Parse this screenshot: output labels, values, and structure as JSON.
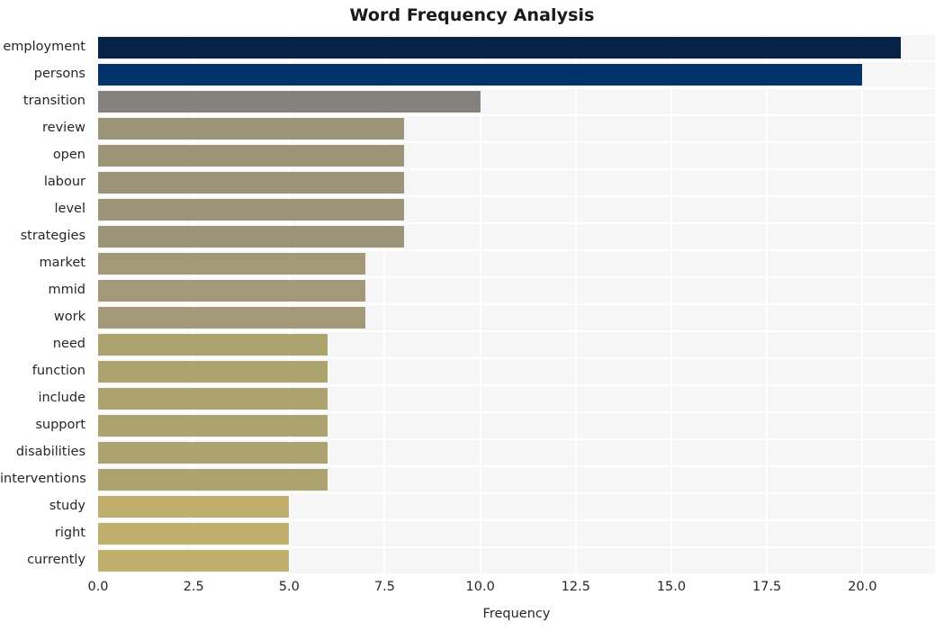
{
  "chart_data": {
    "type": "bar",
    "orientation": "horizontal",
    "title": "Word Frequency Analysis",
    "xlabel": "Frequency",
    "ylabel": "",
    "xlim": [
      0,
      21.9
    ],
    "xticks": [
      "0.0",
      "2.5",
      "5.0",
      "7.5",
      "10.0",
      "12.5",
      "15.0",
      "17.5",
      "20.0"
    ],
    "xtick_values": [
      0,
      2.5,
      5,
      7.5,
      10,
      12.5,
      15,
      17.5,
      20
    ],
    "grid": true,
    "legend": "none",
    "categories": [
      "employment",
      "persons",
      "transition",
      "review",
      "open",
      "labour",
      "level",
      "strategies",
      "market",
      "mmid",
      "work",
      "need",
      "function",
      "include",
      "support",
      "disabilities",
      "interventions",
      "study",
      "right",
      "currently"
    ],
    "values": [
      21,
      20,
      10,
      8,
      8,
      8,
      8,
      8,
      7,
      7,
      7,
      6,
      6,
      6,
      6,
      6,
      6,
      5,
      5,
      5
    ],
    "bar_colors": [
      "#082348",
      "#03336b",
      "#85827e",
      "#9c9478",
      "#9c9478",
      "#9c9478",
      "#9c9478",
      "#9c9478",
      "#a39878",
      "#a39878",
      "#a39878",
      "#ada36f",
      "#ada36f",
      "#ada36f",
      "#ada36f",
      "#ada36f",
      "#ada36f",
      "#bfae6c",
      "#bfae6c",
      "#bfae6c"
    ]
  },
  "style": {
    "plot_background": "#f6f6f6",
    "figure_background": "#ffffff",
    "gridline_color": "#ffffff",
    "text_color": "#262626",
    "title_color": "#1a1a1a"
  }
}
